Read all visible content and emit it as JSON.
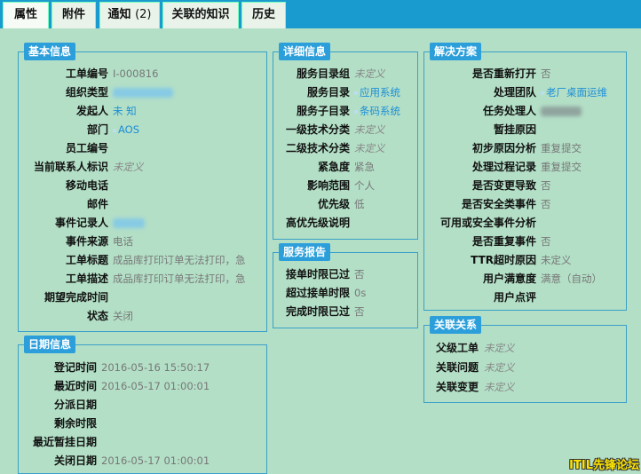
{
  "tabs": [
    {
      "label": "属性"
    },
    {
      "label": "附件"
    },
    {
      "label": "通知",
      "count": "(2)"
    },
    {
      "label": "关联的知识"
    },
    {
      "label": "历史"
    }
  ],
  "basic": {
    "title": "基本信息",
    "rows": [
      {
        "label": "工单编号",
        "value": "I-000816"
      },
      {
        "label": "组织类型",
        "value": ""
      },
      {
        "label": "发起人",
        "value": "未 知"
      },
      {
        "label": "部门",
        "value": "AOS"
      },
      {
        "label": "员工编号",
        "value": ""
      },
      {
        "label": "当前联系人标识",
        "value": "未定义"
      },
      {
        "label": "移动电话",
        "value": ""
      },
      {
        "label": "邮件",
        "value": ""
      },
      {
        "label": "事件记录人",
        "value": ""
      },
      {
        "label": "事件来源",
        "value": "电话"
      },
      {
        "label": "工单标题",
        "value": "成品库打印订单无法打印，急"
      },
      {
        "label": "工单描述",
        "value": "成品库打印订单无法打印，急"
      },
      {
        "label": "期望完成时间",
        "value": ""
      },
      {
        "label": "状态",
        "value": "关闭"
      }
    ]
  },
  "dates": {
    "title": "日期信息",
    "rows": [
      {
        "label": "登记时间",
        "value": "2016-05-16 15:50:17"
      },
      {
        "label": "最近时间",
        "value": "2016-05-17 01:00:01"
      },
      {
        "label": "分派日期",
        "value": ""
      },
      {
        "label": "剩余时限",
        "value": ""
      },
      {
        "label": "最近暂挂日期",
        "value": ""
      },
      {
        "label": "关闭日期",
        "value": "2016-05-17 01:00:01"
      }
    ]
  },
  "detail": {
    "title": "详细信息",
    "rows": [
      {
        "label": "服务目录组",
        "value": "未定义"
      },
      {
        "label": "服务目录",
        "value": "应用系统"
      },
      {
        "label": "服务子目录",
        "value": "条码系统"
      },
      {
        "label": "一级技术分类",
        "value": "未定义"
      },
      {
        "label": "二级技术分类",
        "value": "未定义"
      },
      {
        "label": "紧急度",
        "value": "紧急"
      },
      {
        "label": "影响范围",
        "value": "个人"
      },
      {
        "label": "优先级",
        "value": "低"
      },
      {
        "label": "高优先级说明",
        "value": ""
      }
    ]
  },
  "service_report": {
    "title": "服务报告",
    "rows": [
      {
        "label": "接单时限已过",
        "value": "否"
      },
      {
        "label": "超过接单时限",
        "value": "0s"
      },
      {
        "label": "完成时限已过",
        "value": "否"
      }
    ]
  },
  "solution": {
    "title": "解决方案",
    "rows": [
      {
        "label": "是否重新打开",
        "value": "否"
      },
      {
        "label": "处理团队",
        "value": "老厂桌面运维"
      },
      {
        "label": "任务处理人",
        "value": ""
      },
      {
        "label": "暂挂原因",
        "value": ""
      },
      {
        "label": "初步原因分析",
        "value": "重复提交"
      },
      {
        "label": "处理过程记录",
        "value": "重复提交"
      },
      {
        "label": "是否变更导致",
        "value": "否"
      },
      {
        "label": "是否安全类事件",
        "value": "否"
      },
      {
        "label": "可用或安全事件分析",
        "value": ""
      },
      {
        "label": "是否重复事件",
        "value": "否"
      },
      {
        "label": "TTR超时原因",
        "value": "未定义"
      },
      {
        "label": "用户满意度",
        "value": "满意（自动）"
      },
      {
        "label": "用户点评",
        "value": ""
      }
    ]
  },
  "relations": {
    "title": "关联关系",
    "rows": [
      {
        "label": "父级工单",
        "value": "未定义"
      },
      {
        "label": "关联问题",
        "value": "未定义"
      },
      {
        "label": "关联变更",
        "value": "未定义"
      }
    ]
  },
  "watermark": "ITIL先锋论坛",
  "colors": {
    "background": "#b3dfc6",
    "tabbar": "#1a9bd0",
    "legend": "#2c9fdb",
    "link": "#1d8ed6"
  }
}
